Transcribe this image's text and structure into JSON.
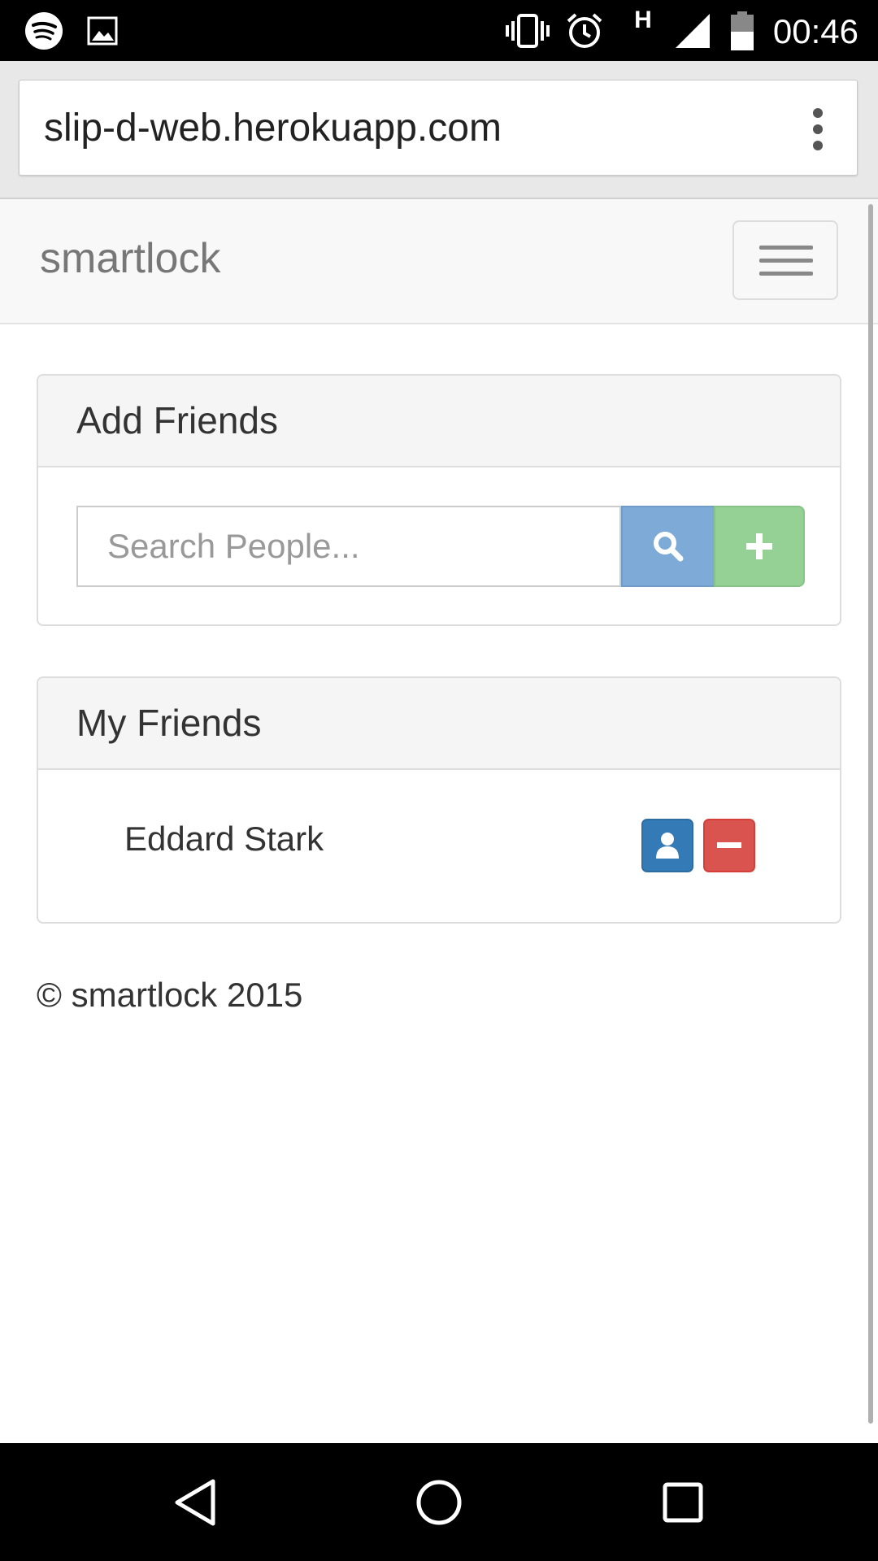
{
  "status_bar": {
    "time": "00:46",
    "network": "H",
    "icons": [
      "spotify-icon",
      "image-icon",
      "vibrate-icon",
      "alarm-icon",
      "signal-icon",
      "battery-icon"
    ]
  },
  "browser": {
    "url": "slip-d-web.herokuapp.com",
    "menu_icon": "more-vert-icon"
  },
  "navbar": {
    "brand": "smartlock",
    "toggle_icon": "hamburger-icon"
  },
  "add_friends": {
    "title": "Add Friends",
    "search_placeholder": "Search People...",
    "search_value": "",
    "search_button_icon": "search-icon",
    "add_button_icon": "plus-icon"
  },
  "my_friends": {
    "title": "My Friends",
    "friends": [
      {
        "name": "Eddard Stark",
        "profile_icon": "user-icon",
        "remove_icon": "minus-icon"
      }
    ]
  },
  "footer": {
    "text": "© smartlock 2015"
  },
  "system_nav": {
    "buttons": [
      "back-icon",
      "home-icon",
      "recents-icon"
    ]
  },
  "colors": {
    "search_button": "#7daad6",
    "add_button": "#95d194",
    "profile_button": "#337ab7",
    "remove_button": "#d9534f",
    "navbar_bg": "#f8f8f8",
    "brand_text": "#777777"
  }
}
